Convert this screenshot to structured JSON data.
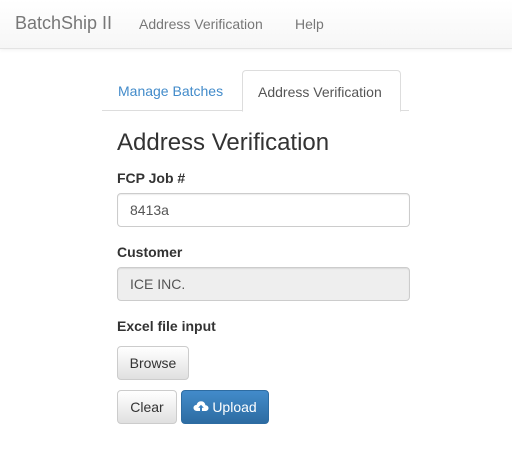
{
  "navbar": {
    "brand": "BatchShip II",
    "links": [
      "Address Verification",
      "Help"
    ]
  },
  "tabs": [
    "Manage Batches",
    "Address Verification"
  ],
  "active_tab": "Address Verification",
  "page_title": "Address Verification",
  "form": {
    "job_label": "FCP Job #",
    "job_value": "8413a",
    "customer_label": "Customer",
    "customer_value": "ICE INC.",
    "excel_label": "Excel file input",
    "browse_label": "Browse",
    "clear_label": "Clear",
    "upload_label": "Upload",
    "upload_icon": "cloud-upload-icon"
  },
  "colors": {
    "link": "#428bca",
    "primary": "#3276b1",
    "navbar_bg": "#f8f8f8",
    "muted": "#777777",
    "readonly_bg": "#eeeeee"
  }
}
